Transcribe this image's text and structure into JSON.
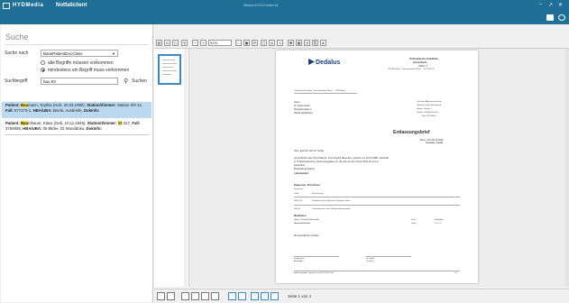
{
  "titlebar": {
    "app_name": "HYDMedia",
    "module": "Notfallclient",
    "center_text": "Version 6.0.0.0 Lesen UI",
    "min": "–",
    "max": "↗",
    "close": "✕"
  },
  "left": {
    "title": "Suche",
    "search_by_label": "Suche nach",
    "search_by_value": "BasePatientDocClass",
    "radio_all": "alle Begriffe müssen vorkommen",
    "radio_one": "mindestens ein Begriff muss vorkommen",
    "term_label": "Suchbegriff",
    "term_value": "bau 83",
    "search_button": "Suchen",
    "results": [
      {
        "prefix": "Patient: ",
        "hl": "Bau",
        "name_rest": "mann, Sophia (Geb. 20.03.1980), ",
        "station_label": "Station/Zimmer: ",
        "station_val": "Station 3/3-12, ",
        "fall_label": "Fall: ",
        "fall_val": "877273-1, ",
        "hba_label": "HBA/UBA: ",
        "hba_val": "Briefe, Ausbriefe, ",
        "dok_label": "DokInfo:"
      },
      {
        "prefix": "Patient: ",
        "hl": "Bau",
        "name_rest": "mhauer, Klaus (Geb. 10.11.1945), ",
        "station_label": "Station/Zimmer: ",
        "station_hl": "83",
        "station_val": "-317, ",
        "fall_label": "Fall: ",
        "fall_val": "3760659, ",
        "hba_label": "HBA/UBA: ",
        "hba_val": "06 Bilder, 02 Wunddoku, ",
        "dok_label": "DokInfo:"
      }
    ]
  },
  "viewer": {
    "zoom": "91%",
    "page_info": "Seite 1 von 1"
  },
  "doc": {
    "logo": "Dedalus",
    "clinic_1": "Orthopädische Fachklinik",
    "clinic_2": "Sonnenheim",
    "clinic_3": "Station 3",
    "clinic_addr": "D-12345 Bonn · Sonnenheimer Platz 1 · Tel. 0228-00",
    "sender_line": "Orthopädische Klinik · Sonnenheimer Platz 1 · 12345 Bonn",
    "recipient_1": "Herrn",
    "recipient_2": "Dr. Klaus Heller",
    "recipient_3": "Ziergartenallee 1",
    "recipient_4": "69120 Heidelberg",
    "right_1": "Facharzt: Allgemeinchirurgie",
    "right_2": "Oberarzt: Julian Reinsbaum",
    "right_3": "Station: Station 3",
    "right_4": "Telefon: 0228-00-00-001",
    "right_5": "Fax: 0228-0000",
    "heading": "Entlassungsbrief",
    "date": "Bonn, den 06.02.2022",
    "dept": "FL003095 / 700295",
    "salutation": "Sehr geehrter Herr Dr. Heller,",
    "para_1": "wir berichten über Ihre Patientin, Frau Sophia Baumann, geboren am 20.03.1980, wohnhaft",
    "para_2": "in 71149 Rottenburg, Hindenburggasse 12, die sich ab dem 01.01.2022 bei uns in",
    "para_3": "stationärer",
    "para_4": "Behandlung befand.",
    "lab": "Laborbefund",
    "diag_heading": "Diagnosen, Prozeduren",
    "diag_sub": "Diagnosen",
    "col_code": "Code",
    "col_desc": "Bezeichnung",
    "diag1_code": "M15.3 GL",
    "diag1_desc": "Knieathrose als Folge einer Dysplasie, links",
    "diag2_code": "Z89.54",
    "diag2_desc": "Vorhandensein eines Hüftgelenkimplantates",
    "med_heading": "Medikation",
    "med_name_col": "Name / Wirkstoff (Wirkstoffe)",
    "med_dose_col": "Dosis",
    "med_hint_col": "Häufigkeit",
    "med1": "Schmerzfrei forte",
    "med1_dose": "10mg",
    "med1_freq": "1-1-1-1",
    "closing": "Mit freundlichen Grüßen",
    "sign_1": "B. Agostina",
    "sign_1b": "Ärztlin/Arzt",
    "sign_2": "Dr. Engel",
    "sign_2b": "Chefarzt",
    "footer": "Entlassungsbrief · gedruckt am 06.02.2022 10:30",
    "footer_page": "1/1"
  }
}
